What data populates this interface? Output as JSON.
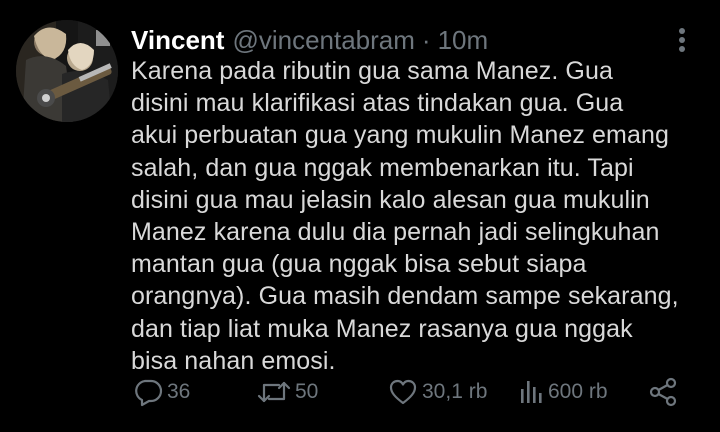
{
  "tweet": {
    "display_name": "Vincent",
    "handle": "@vincentabram",
    "separator": "·",
    "time": "10m",
    "text": "Karena pada ributin gua sama Manez. Gua\ndisini mau klarifikasi atas tindakan gua. Gua\nakui perbuatan gua yang mukulin Manez emang\nsalah, dan gua nggak membenarkan itu. Tapi\ndisini gua mau jelasin kalo alesan gua mukulin\nManez karena dulu dia pernah jadi selingkuhan\nmantan gua (gua nggak bisa sebut siapa\norangnya). Gua masih dendam sampe sekarang,\ndan tiap liat muka Manez rasanya gua nggak\nbisa nahan emosi."
  },
  "actions": {
    "reply": {
      "icon": "reply-icon",
      "count": "36"
    },
    "retweet": {
      "icon": "retweet-icon",
      "count": "50"
    },
    "like": {
      "icon": "heart-icon",
      "count": "30,1 rb"
    },
    "views": {
      "icon": "views-bar-icon",
      "count": "600 rb"
    },
    "share": {
      "icon": "share-icon"
    }
  },
  "colors": {
    "background": "#000000",
    "text_primary": "#ffffff",
    "text_body": "#d9d9d9",
    "text_muted": "#6e767d"
  }
}
